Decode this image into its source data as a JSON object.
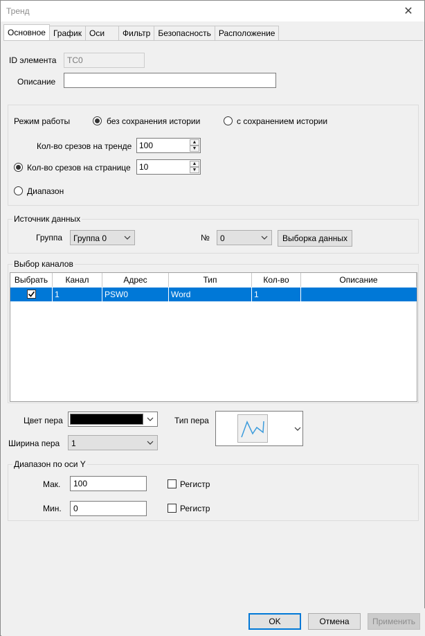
{
  "window": {
    "title": "Тренд",
    "close": "✕"
  },
  "tabs": [
    "Основное",
    "График",
    "Оси",
    "Фильтр",
    "Безопасность",
    "Расположение"
  ],
  "id_field": {
    "label": "ID элемента",
    "value": "TC0"
  },
  "description_field": {
    "label": "Описание",
    "value": ""
  },
  "mode": {
    "label": "Режим работы",
    "option_no_history": "без сохранения истории",
    "option_with_history": "с сохранением истории",
    "slices_on_trend_label": "Кол-во срезов на тренде",
    "slices_on_trend_value": "100",
    "slices_on_page_label": "Кол-во срезов на странице",
    "slices_on_page_value": "10",
    "range_label": "Диапазон"
  },
  "source": {
    "title": "Источник данных",
    "group_label": "Группа",
    "group_value": "Группа 0",
    "number_label": "№",
    "number_value": "0",
    "select_data_button": "Выборка данных"
  },
  "channels": {
    "title": "Выбор каналов",
    "columns": [
      "Выбрать",
      "Канал",
      "Адрес",
      "Тип",
      "Кол-во",
      "Описание"
    ],
    "rows": [
      {
        "selected": true,
        "channel": "1",
        "address": "PSW0",
        "type": "Word",
        "count": "1",
        "description": ""
      }
    ]
  },
  "pen": {
    "color_label": "Цвет пера",
    "color_value": "#000000",
    "width_label": "Ширина пера",
    "width_value": "1",
    "type_label": "Тип пера",
    "type_icon": "line-chart-icon"
  },
  "y_range": {
    "title": "Диапазон по оси Y",
    "max_label": "Мак.",
    "max_value": "100",
    "min_label": "Мин.",
    "min_value": "0",
    "register_label": "Регистр"
  },
  "buttons": {
    "ok": "OK",
    "cancel": "Отмена",
    "apply": "Применить"
  },
  "colors": {
    "accent": "#0078d7",
    "selection": "#0078d7"
  }
}
